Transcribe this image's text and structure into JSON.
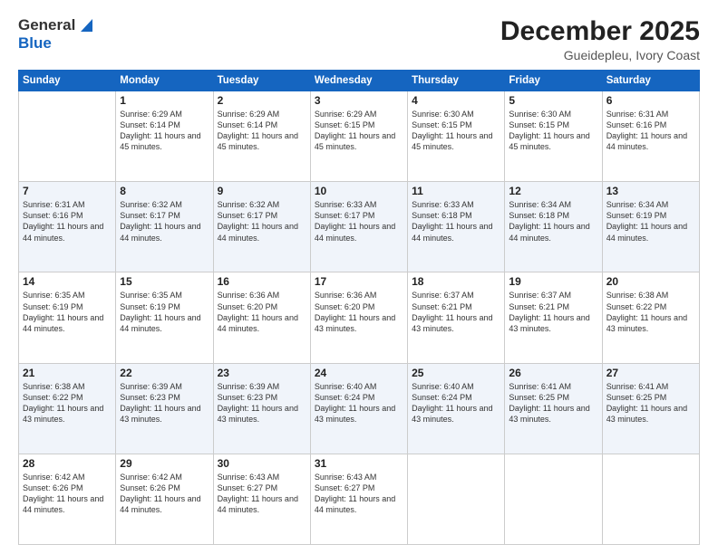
{
  "header": {
    "logo_general": "General",
    "logo_blue": "Blue",
    "month": "December 2025",
    "location": "Gueidepleu, Ivory Coast"
  },
  "weekdays": [
    "Sunday",
    "Monday",
    "Tuesday",
    "Wednesday",
    "Thursday",
    "Friday",
    "Saturday"
  ],
  "weeks": [
    [
      {
        "day": "",
        "sunrise": "",
        "sunset": "",
        "daylight": ""
      },
      {
        "day": "1",
        "sunrise": "Sunrise: 6:29 AM",
        "sunset": "Sunset: 6:14 PM",
        "daylight": "Daylight: 11 hours and 45 minutes."
      },
      {
        "day": "2",
        "sunrise": "Sunrise: 6:29 AM",
        "sunset": "Sunset: 6:14 PM",
        "daylight": "Daylight: 11 hours and 45 minutes."
      },
      {
        "day": "3",
        "sunrise": "Sunrise: 6:29 AM",
        "sunset": "Sunset: 6:15 PM",
        "daylight": "Daylight: 11 hours and 45 minutes."
      },
      {
        "day": "4",
        "sunrise": "Sunrise: 6:30 AM",
        "sunset": "Sunset: 6:15 PM",
        "daylight": "Daylight: 11 hours and 45 minutes."
      },
      {
        "day": "5",
        "sunrise": "Sunrise: 6:30 AM",
        "sunset": "Sunset: 6:15 PM",
        "daylight": "Daylight: 11 hours and 45 minutes."
      },
      {
        "day": "6",
        "sunrise": "Sunrise: 6:31 AM",
        "sunset": "Sunset: 6:16 PM",
        "daylight": "Daylight: 11 hours and 44 minutes."
      }
    ],
    [
      {
        "day": "7",
        "sunrise": "Sunrise: 6:31 AM",
        "sunset": "Sunset: 6:16 PM",
        "daylight": "Daylight: 11 hours and 44 minutes."
      },
      {
        "day": "8",
        "sunrise": "Sunrise: 6:32 AM",
        "sunset": "Sunset: 6:17 PM",
        "daylight": "Daylight: 11 hours and 44 minutes."
      },
      {
        "day": "9",
        "sunrise": "Sunrise: 6:32 AM",
        "sunset": "Sunset: 6:17 PM",
        "daylight": "Daylight: 11 hours and 44 minutes."
      },
      {
        "day": "10",
        "sunrise": "Sunrise: 6:33 AM",
        "sunset": "Sunset: 6:17 PM",
        "daylight": "Daylight: 11 hours and 44 minutes."
      },
      {
        "day": "11",
        "sunrise": "Sunrise: 6:33 AM",
        "sunset": "Sunset: 6:18 PM",
        "daylight": "Daylight: 11 hours and 44 minutes."
      },
      {
        "day": "12",
        "sunrise": "Sunrise: 6:34 AM",
        "sunset": "Sunset: 6:18 PM",
        "daylight": "Daylight: 11 hours and 44 minutes."
      },
      {
        "day": "13",
        "sunrise": "Sunrise: 6:34 AM",
        "sunset": "Sunset: 6:19 PM",
        "daylight": "Daylight: 11 hours and 44 minutes."
      }
    ],
    [
      {
        "day": "14",
        "sunrise": "Sunrise: 6:35 AM",
        "sunset": "Sunset: 6:19 PM",
        "daylight": "Daylight: 11 hours and 44 minutes."
      },
      {
        "day": "15",
        "sunrise": "Sunrise: 6:35 AM",
        "sunset": "Sunset: 6:19 PM",
        "daylight": "Daylight: 11 hours and 44 minutes."
      },
      {
        "day": "16",
        "sunrise": "Sunrise: 6:36 AM",
        "sunset": "Sunset: 6:20 PM",
        "daylight": "Daylight: 11 hours and 44 minutes."
      },
      {
        "day": "17",
        "sunrise": "Sunrise: 6:36 AM",
        "sunset": "Sunset: 6:20 PM",
        "daylight": "Daylight: 11 hours and 43 minutes."
      },
      {
        "day": "18",
        "sunrise": "Sunrise: 6:37 AM",
        "sunset": "Sunset: 6:21 PM",
        "daylight": "Daylight: 11 hours and 43 minutes."
      },
      {
        "day": "19",
        "sunrise": "Sunrise: 6:37 AM",
        "sunset": "Sunset: 6:21 PM",
        "daylight": "Daylight: 11 hours and 43 minutes."
      },
      {
        "day": "20",
        "sunrise": "Sunrise: 6:38 AM",
        "sunset": "Sunset: 6:22 PM",
        "daylight": "Daylight: 11 hours and 43 minutes."
      }
    ],
    [
      {
        "day": "21",
        "sunrise": "Sunrise: 6:38 AM",
        "sunset": "Sunset: 6:22 PM",
        "daylight": "Daylight: 11 hours and 43 minutes."
      },
      {
        "day": "22",
        "sunrise": "Sunrise: 6:39 AM",
        "sunset": "Sunset: 6:23 PM",
        "daylight": "Daylight: 11 hours and 43 minutes."
      },
      {
        "day": "23",
        "sunrise": "Sunrise: 6:39 AM",
        "sunset": "Sunset: 6:23 PM",
        "daylight": "Daylight: 11 hours and 43 minutes."
      },
      {
        "day": "24",
        "sunrise": "Sunrise: 6:40 AM",
        "sunset": "Sunset: 6:24 PM",
        "daylight": "Daylight: 11 hours and 43 minutes."
      },
      {
        "day": "25",
        "sunrise": "Sunrise: 6:40 AM",
        "sunset": "Sunset: 6:24 PM",
        "daylight": "Daylight: 11 hours and 43 minutes."
      },
      {
        "day": "26",
        "sunrise": "Sunrise: 6:41 AM",
        "sunset": "Sunset: 6:25 PM",
        "daylight": "Daylight: 11 hours and 43 minutes."
      },
      {
        "day": "27",
        "sunrise": "Sunrise: 6:41 AM",
        "sunset": "Sunset: 6:25 PM",
        "daylight": "Daylight: 11 hours and 43 minutes."
      }
    ],
    [
      {
        "day": "28",
        "sunrise": "Sunrise: 6:42 AM",
        "sunset": "Sunset: 6:26 PM",
        "daylight": "Daylight: 11 hours and 44 minutes."
      },
      {
        "day": "29",
        "sunrise": "Sunrise: 6:42 AM",
        "sunset": "Sunset: 6:26 PM",
        "daylight": "Daylight: 11 hours and 44 minutes."
      },
      {
        "day": "30",
        "sunrise": "Sunrise: 6:43 AM",
        "sunset": "Sunset: 6:27 PM",
        "daylight": "Daylight: 11 hours and 44 minutes."
      },
      {
        "day": "31",
        "sunrise": "Sunrise: 6:43 AM",
        "sunset": "Sunset: 6:27 PM",
        "daylight": "Daylight: 11 hours and 44 minutes."
      },
      {
        "day": "",
        "sunrise": "",
        "sunset": "",
        "daylight": ""
      },
      {
        "day": "",
        "sunrise": "",
        "sunset": "",
        "daylight": ""
      },
      {
        "day": "",
        "sunrise": "",
        "sunset": "",
        "daylight": ""
      }
    ]
  ]
}
